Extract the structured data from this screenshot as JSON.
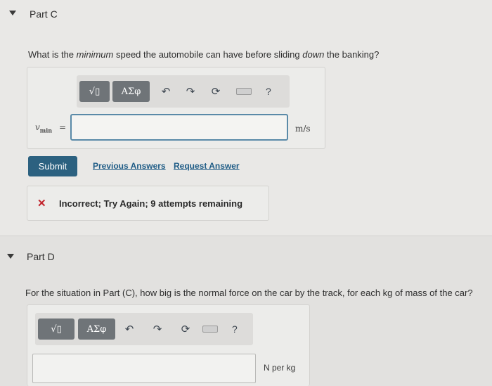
{
  "part_c": {
    "title": "Part C",
    "question_prefix": "What is the ",
    "question_emph": "minimum",
    "question_mid": " speed the automobile can have before sliding ",
    "question_emph2": "down",
    "question_suffix": " the banking?",
    "variable_symbol": "v",
    "variable_subscript": "min",
    "equals": "=",
    "input_value": "",
    "unit": "m/s",
    "submit_label": "Submit",
    "previous_answers_label": "Previous Answers",
    "request_answer_label": "Request Answer",
    "feedback_text": "Incorrect; Try Again; 9 attempts remaining",
    "feedback_icon": "x-icon",
    "feedback_color": "#c2242c"
  },
  "toolbar": {
    "templates_label": "√▯",
    "greek_label": "ΑΣφ",
    "help_label": "?"
  },
  "part_d": {
    "title": "Part D",
    "question": "For the situation in Part (C), how big is the normal force on the car by the track, for each kg of mass of the car?",
    "input_value": "",
    "unit": "N per kg"
  },
  "colors": {
    "submit_bg": "#2c6180",
    "link": "#1f5c86",
    "input_border": "#5a8aa8"
  }
}
